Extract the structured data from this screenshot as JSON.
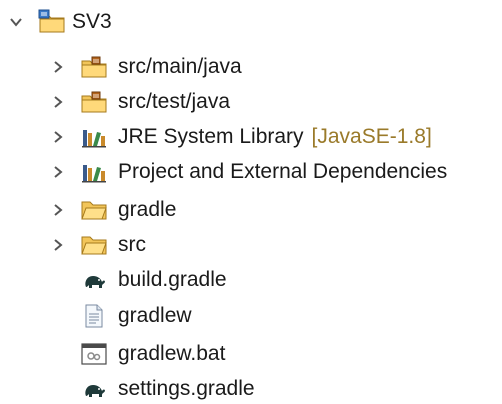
{
  "tree": {
    "root": {
      "label": "SV3",
      "icon": "gradle-project-folder-icon",
      "expanded": true
    },
    "items": [
      {
        "label": "src/main/java",
        "icon": "source-folder-icon",
        "expandable": true
      },
      {
        "label": "src/test/java",
        "icon": "source-folder-icon",
        "expandable": true
      },
      {
        "label": "JRE System Library",
        "decoration": "[JavaSE-1.8]",
        "icon": "library-icon",
        "expandable": true
      },
      {
        "label": "Project and External Dependencies",
        "icon": "library-icon",
        "expandable": true
      },
      {
        "label": "gradle",
        "icon": "folder-icon",
        "expandable": true
      },
      {
        "label": "src",
        "icon": "folder-icon",
        "expandable": true
      },
      {
        "label": "build.gradle",
        "icon": "gradle-elephant-icon",
        "expandable": false
      },
      {
        "label": "gradlew",
        "icon": "text-file-icon",
        "expandable": false
      },
      {
        "label": "gradlew.bat",
        "icon": "batch-file-icon",
        "expandable": false
      },
      {
        "label": "settings.gradle",
        "icon": "gradle-elephant-icon",
        "expandable": false
      }
    ]
  },
  "colors": {
    "text": "#1a1a1a",
    "decoration": "#9a7a2a",
    "twisty": "#555555",
    "folder": "#e8b84a",
    "elephant": "#1f3a3a"
  }
}
